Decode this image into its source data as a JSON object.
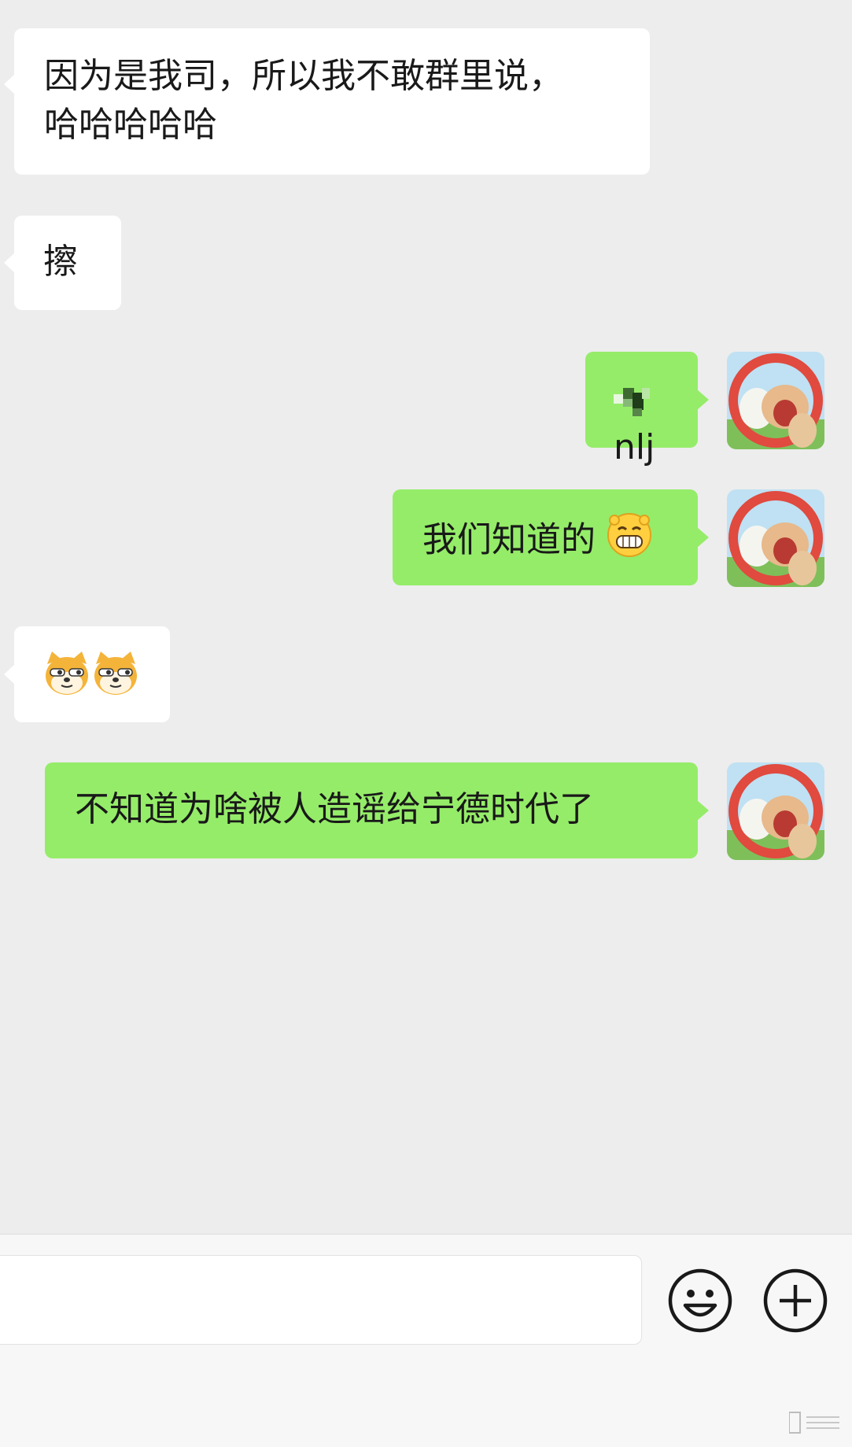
{
  "messages": [
    {
      "side": "in",
      "text_line1": "因为是我司，所以我不敢群里说，",
      "text_line2": "哈哈哈哈哈"
    },
    {
      "side": "in",
      "text": "擦"
    },
    {
      "side": "out",
      "text": "nlj",
      "redacted": true
    },
    {
      "side": "out",
      "text": "我们知道的",
      "emoji": "grin-emoji"
    },
    {
      "side": "in",
      "emoji": [
        "doge-emoji",
        "doge-emoji"
      ]
    },
    {
      "side": "out",
      "text": "不知道为啥被人造谣给宁德时代了"
    }
  ],
  "icons": {
    "emoji_button": "smiley-face-icon",
    "more_button": "plus-circle-icon"
  },
  "colors": {
    "background": "#ededed",
    "incoming_bubble": "#ffffff",
    "outgoing_bubble": "#95ec69",
    "text": "#191919"
  }
}
